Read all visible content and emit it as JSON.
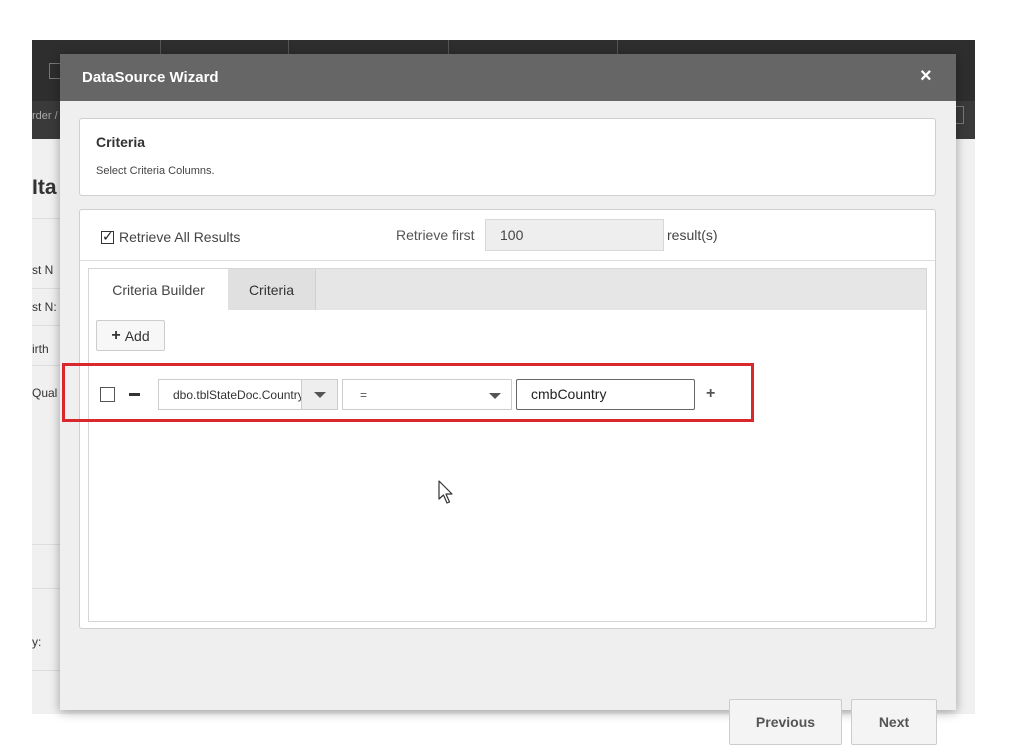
{
  "background_app": {
    "order_text": "rder /",
    "heading": "Ita",
    "labels": [
      "st N",
      "st N:",
      "irth",
      "Qual",
      "y:"
    ]
  },
  "modal": {
    "title": "DataSource Wizard",
    "close_icon": "×"
  },
  "criteria_panel": {
    "title": "Criteria",
    "subtitle": "Select Criteria Columns."
  },
  "retrieve": {
    "all_results_label": "Retrieve All Results",
    "all_results_checked": true,
    "first_label": "Retrieve first",
    "count_value": "100",
    "results_label": "result(s)"
  },
  "tabs": [
    {
      "label": "Criteria Builder",
      "active": true
    },
    {
      "label": "Criteria",
      "active": false
    }
  ],
  "add_button": {
    "icon": "+",
    "label": "Add"
  },
  "criteria_row": {
    "checked": false,
    "column_value": "dbo.tblStateDoc.Country",
    "operator_value": "=",
    "value_text": "cmbCountry"
  },
  "footer": {
    "previous_label": "Previous",
    "next_label": "Next"
  },
  "colors": {
    "modal_header": "#666666",
    "highlight": "#d9272e",
    "body_bg": "#efefef"
  }
}
